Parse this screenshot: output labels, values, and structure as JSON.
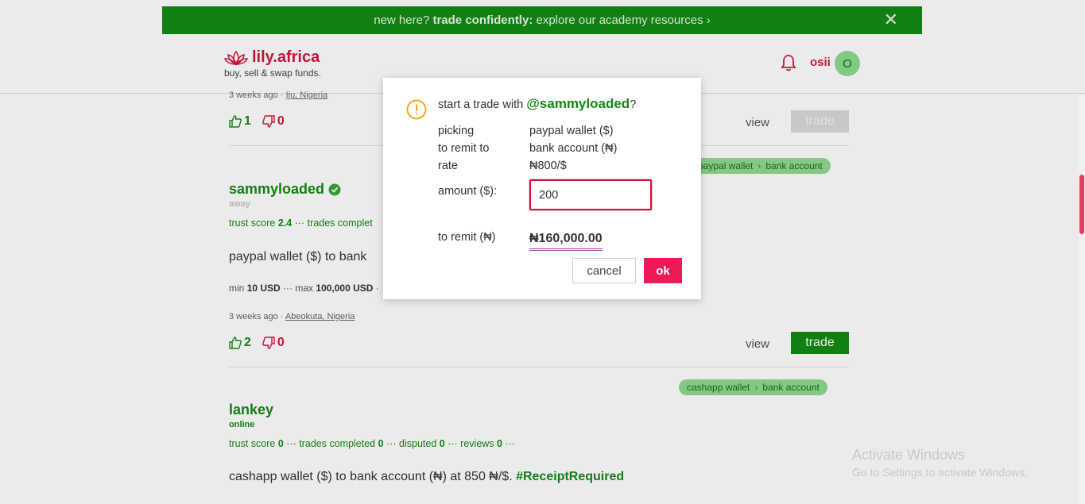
{
  "banner": {
    "prefix": "new here?",
    "bold": "trade confidently:",
    "suffix": "explore our academy resources ›",
    "close": "✕"
  },
  "header": {
    "brand": "lily.africa",
    "tagline": "buy, sell & swap funds.",
    "username": "osii",
    "avatar_initial": "O"
  },
  "listings": {
    "first": {
      "meta_time": "3 weeks ago",
      "meta_sep": "·",
      "meta_location": "Iju, Nigeria",
      "likes": "1",
      "dislikes": "0",
      "view": "view",
      "trade": "trade"
    },
    "second": {
      "pill_from": "paypal wallet",
      "pill_sep": "›",
      "pill_to": "bank account",
      "name": "sammyloaded",
      "status": "away",
      "stats_prefix": "trust score",
      "trust": "2.4",
      "stats_rest": "··· trades complet",
      "desc": "paypal wallet ($) to bank",
      "limits_min_label": "min",
      "limits_min": "10 USD",
      "limits_mid": "··· max",
      "limits_max": "100,000 USD",
      "limits_tail": "·",
      "meta_time": "3 weeks ago",
      "meta_sep": "·",
      "meta_location": "Abeokuta, Nigeria",
      "likes": "2",
      "dislikes": "0",
      "view": "view",
      "trade": "trade"
    },
    "third": {
      "pill_from": "cashapp wallet",
      "pill_sep": "›",
      "pill_to": "bank account",
      "name": "lankey",
      "status": "online",
      "trust_label": "trust score",
      "trust": "0",
      "completed_label": "··· trades completed",
      "completed": "0",
      "disputed_label": "··· disputed",
      "disputed": "0",
      "reviews_label": "··· reviews",
      "reviews": "0",
      "stats_tail": "···",
      "desc": "cashapp wallet ($) to bank account (₦) at 850 ₦/$.",
      "hashtag": "#ReceiptRequired"
    }
  },
  "modal": {
    "title_prefix": "start a trade with",
    "handle": "@sammyloaded",
    "title_suffix": "?",
    "picking_label": "picking",
    "picking_value": "paypal wallet ($)",
    "remit_to_label": "to remit to",
    "remit_to_value": "bank account (₦)",
    "rate_label": "rate",
    "rate_value": "₦800/$",
    "amount_label": "amount ($):",
    "amount_value": "200",
    "to_remit_label": "to remit (₦)",
    "to_remit_value": "₦160,000.00",
    "cancel": "cancel",
    "ok": "ok"
  },
  "watermark": {
    "line1": "Activate Windows",
    "line2": "Go to Settings to activate Windows."
  },
  "colors": {
    "green": "#138a13",
    "brand_red": "#d6163e",
    "ok_pink": "#ee1a58",
    "pill_green": "#8fd98f"
  }
}
